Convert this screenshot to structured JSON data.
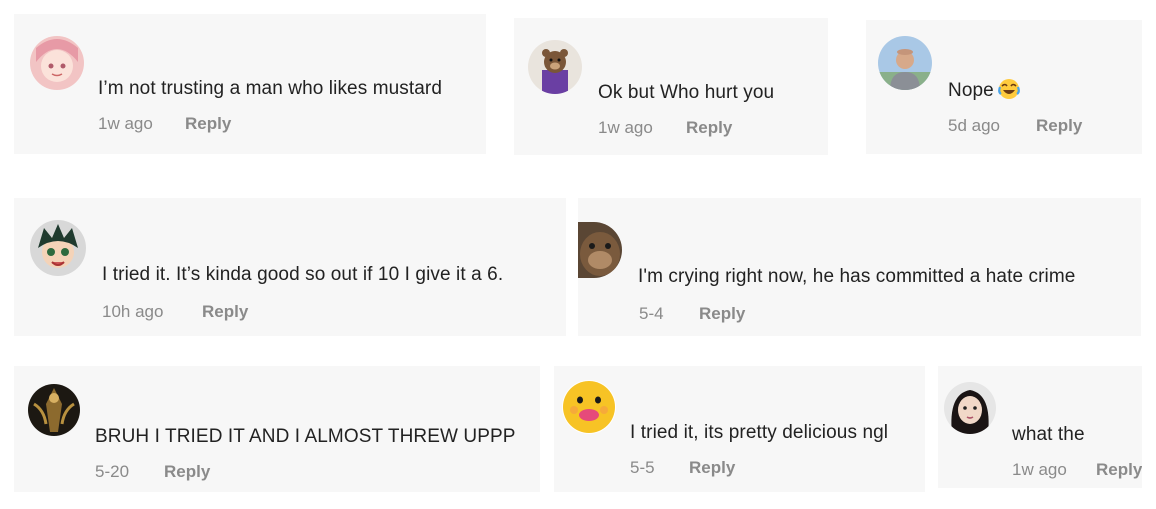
{
  "comments": [
    {
      "text": "I’m not trusting a man who likes mustard",
      "time": "1w ago",
      "reply": "Reply"
    },
    {
      "text": "Ok but Who hurt you",
      "time": "1w ago",
      "reply": "Reply"
    },
    {
      "text": "Nope",
      "emoji": "joy-emoji",
      "time": "5d ago",
      "reply": "Reply"
    },
    {
      "text": "I tried it. It’s kinda good so out if 10 I give it a 6.",
      "time": "10h ago",
      "reply": "Reply"
    },
    {
      "text": "I'm crying right now, he has committed a hate crime",
      "time": "5-4",
      "reply": "Reply"
    },
    {
      "text": "BRUH I TRIED IT AND I ALMOST THREW UPPP",
      "time": "5-20",
      "reply": "Reply"
    },
    {
      "text": "I tried it, its pretty delicious ngl",
      "time": "5-5",
      "reply": "Reply"
    },
    {
      "text": "what the",
      "time": "1w ago",
      "reply": "Reply"
    }
  ],
  "avatars": [
    "anime-girl-avatar",
    "bear-avatar",
    "man-avatar",
    "anime-boy-avatar",
    "monkey-avatar",
    "dark-figure-avatar",
    "smiley-face-avatar",
    "girl-avatar"
  ],
  "colors": {
    "card_bg": "#f7f7f7",
    "text": "#222222",
    "meta": "#8a8a8a"
  }
}
